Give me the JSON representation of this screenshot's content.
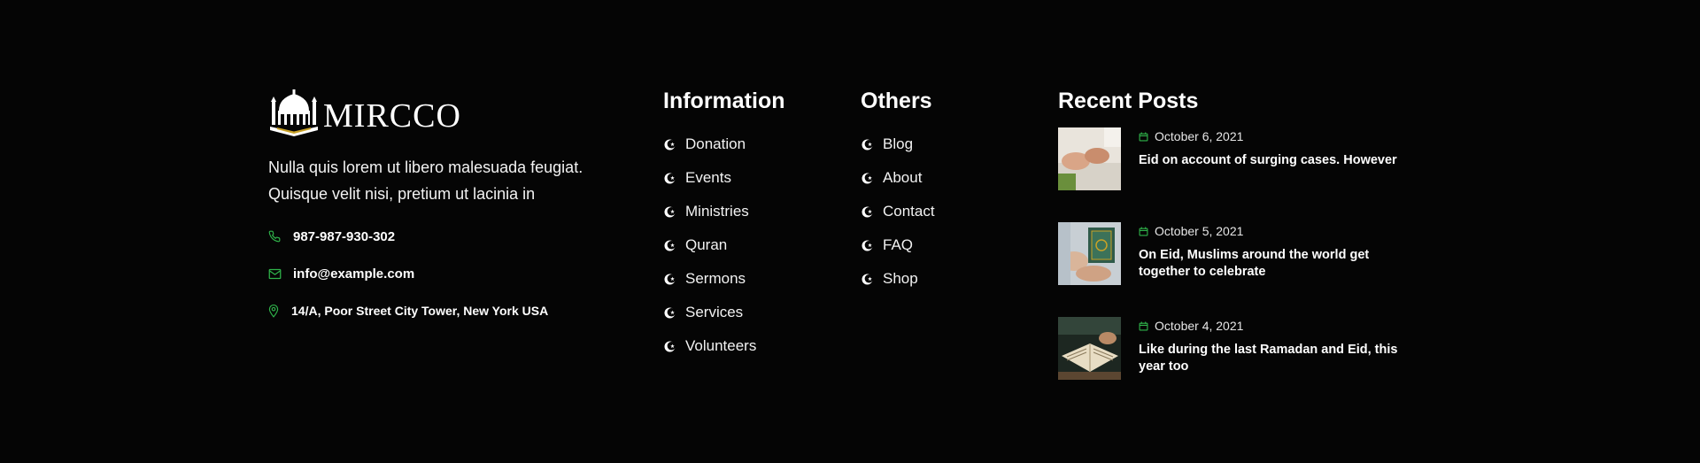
{
  "brand": {
    "name": "MIRCCO",
    "about": "Nulla quis lorem ut libero malesuada feugiat. Quisque velit nisi, pretium ut lacinia in",
    "phone": "987-987-930-302",
    "email": "info@example.com",
    "address": "14/A, Poor Street City Tower, New York USA"
  },
  "information": {
    "title": "Information",
    "links": [
      {
        "label": "Donation"
      },
      {
        "label": "Events"
      },
      {
        "label": "Ministries"
      },
      {
        "label": "Quran"
      },
      {
        "label": "Sermons"
      },
      {
        "label": "Services"
      },
      {
        "label": "Volunteers"
      }
    ]
  },
  "others": {
    "title": "Others",
    "links": [
      {
        "label": "Blog"
      },
      {
        "label": "About"
      },
      {
        "label": "Contact"
      },
      {
        "label": "FAQ"
      },
      {
        "label": "Shop"
      }
    ]
  },
  "recent_posts": {
    "title": "Recent Posts",
    "posts": [
      {
        "date": "October 6, 2021",
        "title": "Eid on account of surging cases. However"
      },
      {
        "date": "October 5, 2021",
        "title": "On Eid, Muslims around the world get together to celebrate"
      },
      {
        "date": "October 4, 2021",
        "title": "Like during the last Ramadan and Eid, this year too"
      }
    ]
  },
  "colors": {
    "background": "#050505",
    "accent_green": "#2fb34a",
    "logo_gold": "#c9a227",
    "text": "#ffffff"
  },
  "icons": {
    "phone": "phone-icon",
    "email": "envelope-icon",
    "address": "map-pin-icon",
    "link_bullet": "crescent-star-icon",
    "date": "calendar-icon"
  }
}
